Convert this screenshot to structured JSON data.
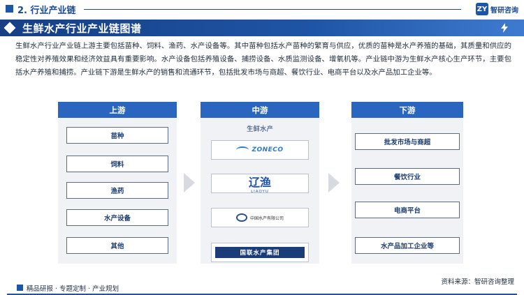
{
  "header": {
    "section": "2. 行业产业链",
    "logo_text": "智研咨询",
    "logo_mark": "ZY"
  },
  "banner": {
    "title": "生鲜水产行业产业链图谱"
  },
  "intro": "生鲜水产行业产业链上游主要包括苗种、饲料、渔药、水产设备等。其中苗种包括水产苗种的繁育与供应，优质的苗种是水产养殖的基础，其质量和供应的稳定性对养殖效果和经济效益具有重要影响。水产设备包括养殖设备、捕捞设备、水质监测设备、增氧机等。产业链中游为生鲜水产核心生产环节，主要包括水产养殖和捕捞。产业链下游是生鲜水产的销售和流通环节，包括批发市场与商超、餐饮行业、电商平台以及水产品加工企业等。",
  "upstream": {
    "title": "上游",
    "items": [
      "苗种",
      "饲料",
      "渔药",
      "水产设备",
      "其他"
    ]
  },
  "midstream": {
    "title": "中游",
    "label": "生鲜水产",
    "logos": {
      "zoneco": "ZONECO",
      "liaoyu_mark": "辽渔",
      "liaoyu_text": "LIAOYU",
      "cnfc": "中国水产有限公司",
      "guolian": "国联水产集团"
    }
  },
  "downstream": {
    "title": "下游",
    "items": [
      "批发市场与商超",
      "餐饮行业",
      "电商平台",
      "水产品加工企业等"
    ]
  },
  "footer": {
    "left": "精品研报 · 专题定制 · 产业规划",
    "source": "资料来源：智研咨询整理"
  },
  "colors": {
    "primary": "#1f55a6",
    "panel_header": "#2a66c0",
    "panel_bg": "#f0f2f5"
  }
}
